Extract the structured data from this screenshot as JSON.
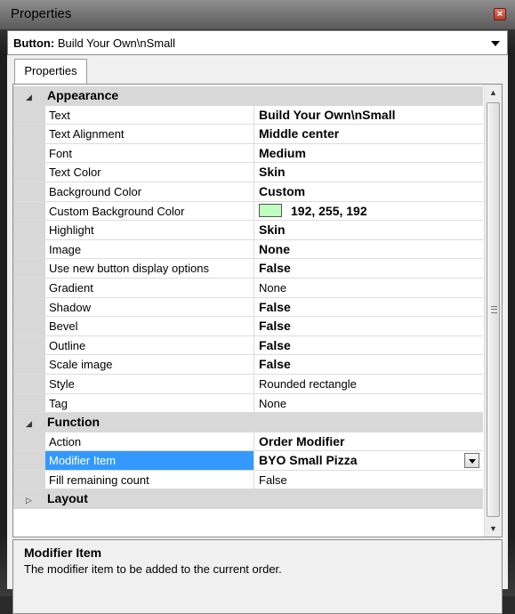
{
  "window": {
    "title": "Properties"
  },
  "object_selector": {
    "type_label": "Button:",
    "name": "Build Your Own\\nSmall"
  },
  "tabs": [
    {
      "label": "Properties"
    }
  ],
  "categories": {
    "appearance": {
      "label": "Appearance",
      "properties": [
        {
          "name": "Text",
          "value": "Build Your Own\\nSmall",
          "bold": true
        },
        {
          "name": "Text Alignment",
          "value": "Middle center",
          "bold": true
        },
        {
          "name": "Font",
          "value": "Medium",
          "bold": true
        },
        {
          "name": "Text Color",
          "value": "Skin",
          "bold": true
        },
        {
          "name": "Background Color",
          "value": "Custom",
          "bold": true
        },
        {
          "name": "Custom Background Color",
          "value": "192, 255, 192",
          "bold": true,
          "swatch": "#c0ffc0"
        },
        {
          "name": "Highlight",
          "value": "Skin",
          "bold": true
        },
        {
          "name": "Image",
          "value": "None",
          "bold": true
        },
        {
          "name": "Use new button display options",
          "value": "False",
          "bold": true
        },
        {
          "name": "Gradient",
          "value": "None",
          "bold": false
        },
        {
          "name": "Shadow",
          "value": "False",
          "bold": true
        },
        {
          "name": "Bevel",
          "value": "False",
          "bold": true
        },
        {
          "name": "Outline",
          "value": "False",
          "bold": true
        },
        {
          "name": "Scale image",
          "value": "False",
          "bold": true
        },
        {
          "name": "Style",
          "value": "Rounded rectangle",
          "bold": false
        },
        {
          "name": "Tag",
          "value": "None",
          "bold": false
        }
      ]
    },
    "function": {
      "label": "Function",
      "properties": [
        {
          "name": "Action",
          "value": "Order Modifier",
          "bold": true
        },
        {
          "name": "Modifier Item",
          "value": "BYO Small Pizza",
          "bold": true,
          "selected": true
        },
        {
          "name": "Fill remaining count",
          "value": "False",
          "bold": false
        }
      ]
    },
    "layout": {
      "label": "Layout"
    }
  },
  "help": {
    "title": "Modifier Item",
    "description": "The modifier item to be added to the current order."
  },
  "colors": {
    "selection": "#3399ff",
    "category_bg": "#d8d8d8",
    "swatch": "#c0ffc0"
  }
}
